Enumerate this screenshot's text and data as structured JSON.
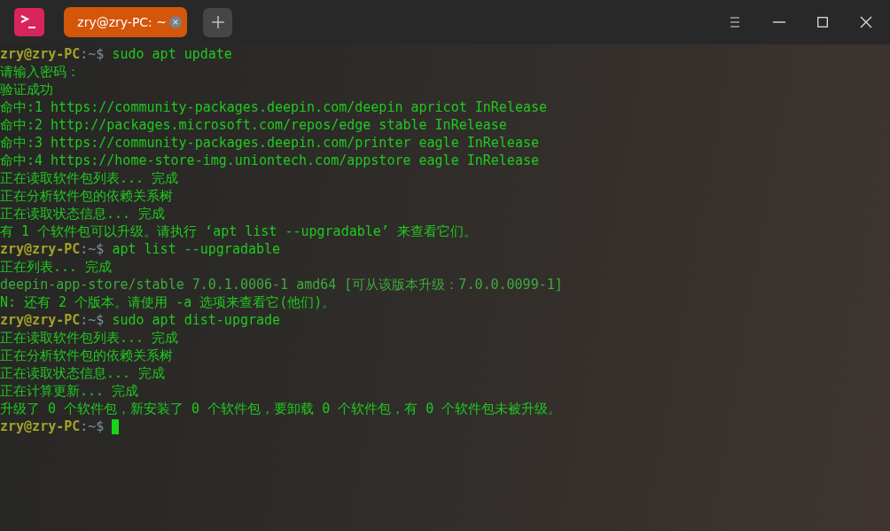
{
  "tabs": [
    {
      "title": "zry@zry-PC: ~",
      "selected": true
    }
  ],
  "terminal": {
    "lines": [
      {
        "kind": "prompt",
        "user": "zry@zry-PC",
        "separator": ":",
        "path": "~",
        "symbol": "$",
        "command": "sudo apt update"
      },
      {
        "kind": "output",
        "text": "请输入密码："
      },
      {
        "kind": "output",
        "text": "验证成功"
      },
      {
        "kind": "output",
        "text": "命中:1 https://community-packages.deepin.com/deepin apricot InRelease"
      },
      {
        "kind": "output",
        "text": "命中:2 http://packages.microsoft.com/repos/edge stable InRelease"
      },
      {
        "kind": "output",
        "text": "命中:3 https://community-packages.deepin.com/printer eagle InRelease"
      },
      {
        "kind": "output",
        "text": "命中:4 https://home-store-img.uniontech.com/appstore eagle InRelease"
      },
      {
        "kind": "output",
        "text": "正在读取软件包列表... 完成"
      },
      {
        "kind": "output",
        "text": "正在分析软件包的依赖关系树"
      },
      {
        "kind": "output",
        "text": "正在读取状态信息... 完成"
      },
      {
        "kind": "output",
        "text": "有 1 个软件包可以升级。请执行 ‘apt list --upgradable’ 来查看它们。"
      },
      {
        "kind": "prompt",
        "user": "zry@zry-PC",
        "separator": ":",
        "path": "~",
        "symbol": "$",
        "command": "apt list --upgradable"
      },
      {
        "kind": "output",
        "text": "正在列表... 完成"
      },
      {
        "kind": "plain",
        "text": "deepin-app-store/stable 7.0.1.0006-1 amd64 [可从该版本升级：7.0.0.0099-1]"
      },
      {
        "kind": "output",
        "text": "N: 还有 2 个版本。请使用 -a 选项来查看它(他们)。"
      },
      {
        "kind": "prompt",
        "user": "zry@zry-PC",
        "separator": ":",
        "path": "~",
        "symbol": "$",
        "command": "sudo apt dist-upgrade"
      },
      {
        "kind": "output",
        "text": "正在读取软件包列表... 完成"
      },
      {
        "kind": "output",
        "text": "正在分析软件包的依赖关系树"
      },
      {
        "kind": "output",
        "text": "正在读取状态信息... 完成"
      },
      {
        "kind": "output",
        "text": "正在计算更新... 完成"
      },
      {
        "kind": "output",
        "text": "升级了 0 个软件包，新安装了 0 个软件包，要卸载 0 个软件包，有 0 个软件包未被升级。"
      },
      {
        "kind": "prompt",
        "user": "zry@zry-PC",
        "separator": ":",
        "path": "~",
        "symbol": "$",
        "cursor": true
      }
    ]
  }
}
